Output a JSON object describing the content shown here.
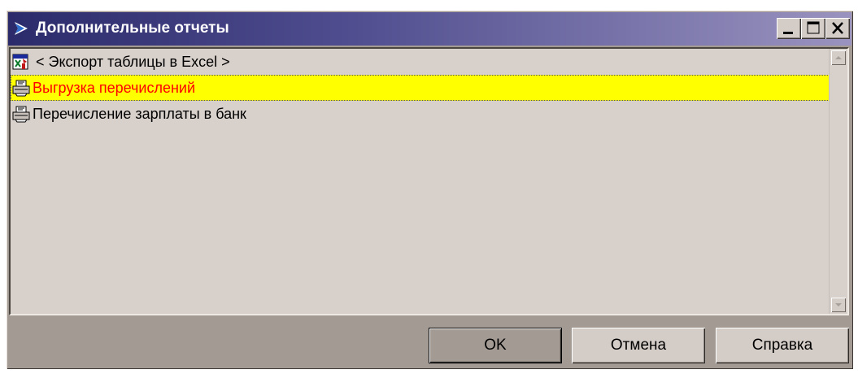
{
  "window": {
    "title": "Дополнительные отчеты",
    "title_icon": "report-arrow-icon",
    "controls": [
      "minimize-icon",
      "maximize-icon",
      "close-icon"
    ]
  },
  "list": {
    "items": [
      {
        "label": "< Экспорт таблицы в Excel >",
        "icon": "excel-export-icon",
        "selected": false
      },
      {
        "label": "Выгрузка перечислений",
        "icon": "printer-icon",
        "selected": true
      },
      {
        "label": "Перечисление зарплаты в банк",
        "icon": "printer-icon",
        "selected": false
      }
    ]
  },
  "buttons": {
    "ok": "OK",
    "cancel": "Отмена",
    "help": "Справка"
  },
  "colors": {
    "selection_bg": "#ffff00",
    "selection_text": "#ff0000",
    "titlebar_start": "#2b2a6a",
    "titlebar_end": "#9a93bf"
  }
}
